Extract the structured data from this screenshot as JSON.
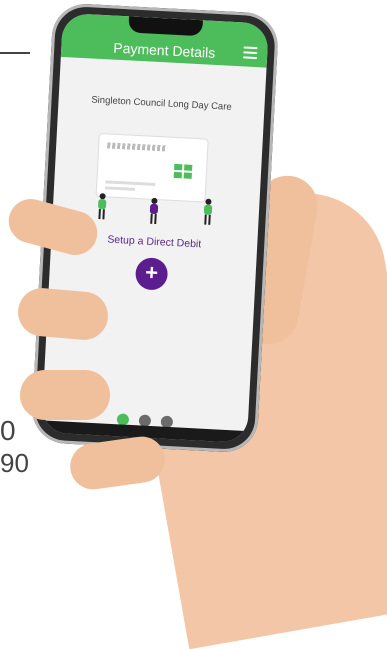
{
  "app": {
    "header_title": "Payment Details",
    "org_name": "Singleton Council Long Day Care",
    "setup_label": "Setup a Direct Debit",
    "add_symbol": "+"
  },
  "pagination": {
    "dots": [
      {
        "color": "#4cbd5a",
        "active": true
      },
      {
        "color": "#6b6b6b",
        "active": false
      },
      {
        "color": "#6b6b6b",
        "active": false
      }
    ]
  },
  "colors": {
    "header": "#4cbd5a",
    "accent_purple": "#5c1d8f"
  },
  "illustration": {
    "people_colors": [
      "#4cbd5a",
      "#5c1d8f",
      "#4cbd5a"
    ]
  },
  "background": {
    "text_line1": "0",
    "text_line2": "90"
  }
}
